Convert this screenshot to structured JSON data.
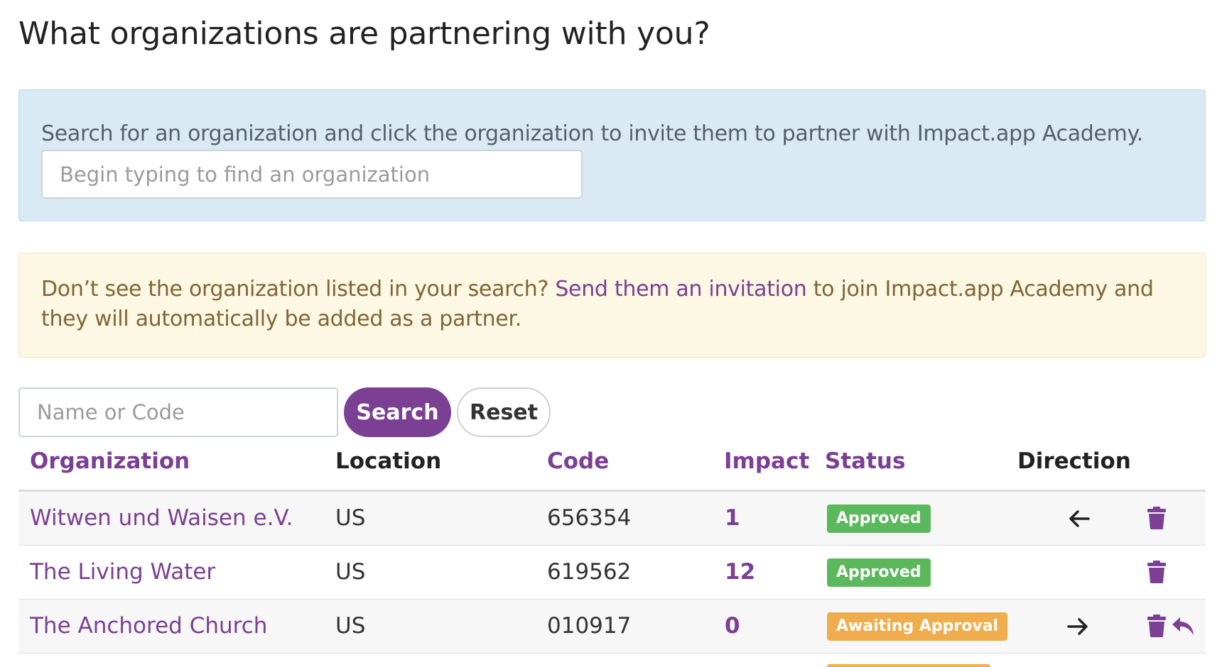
{
  "page": {
    "title": "What organizations are partnering with you?"
  },
  "info_panel": {
    "text": "Search for an organization and click the organization to invite them to partner with Impact.app Academy.",
    "search_placeholder": "Begin typing to find an organization"
  },
  "notice": {
    "text_before": "Don’t see the organization listed in your search? ",
    "link_text": "Send them an invitation",
    "text_after": " to join Impact.app Academy and they will automatically be added as a partner."
  },
  "filter": {
    "placeholder": "Name or Code",
    "search_label": "Search",
    "reset_label": "Reset"
  },
  "table": {
    "headers": {
      "organization": "Organization",
      "location": "Location",
      "code": "Code",
      "impact": "Impact",
      "status": "Status",
      "direction": "Direction"
    },
    "rows": [
      {
        "organization": "Witwen und Waisen e.V.",
        "location": "US",
        "code": "656354",
        "impact": "1",
        "status": "Approved",
        "direction": "arrow-left-icon",
        "actions": [
          "trash-icon"
        ]
      },
      {
        "organization": "The Living Water",
        "location": "US",
        "code": "619562",
        "impact": "12",
        "status": "Approved",
        "direction": "",
        "actions": [
          "trash-icon"
        ]
      },
      {
        "organization": "The Anchored Church",
        "location": "US",
        "code": "010917",
        "impact": "0",
        "status": "Awaiting Approval",
        "direction": "arrow-right-icon",
        "actions": [
          "trash-icon",
          "reply-icon"
        ]
      }
    ]
  },
  "colors": {
    "brand": "#7b3f94",
    "approved": "#5cb85c",
    "awaiting": "#f0ad4e",
    "info_bg": "#d9eaf5",
    "warning_bg": "#fcf8e3"
  }
}
